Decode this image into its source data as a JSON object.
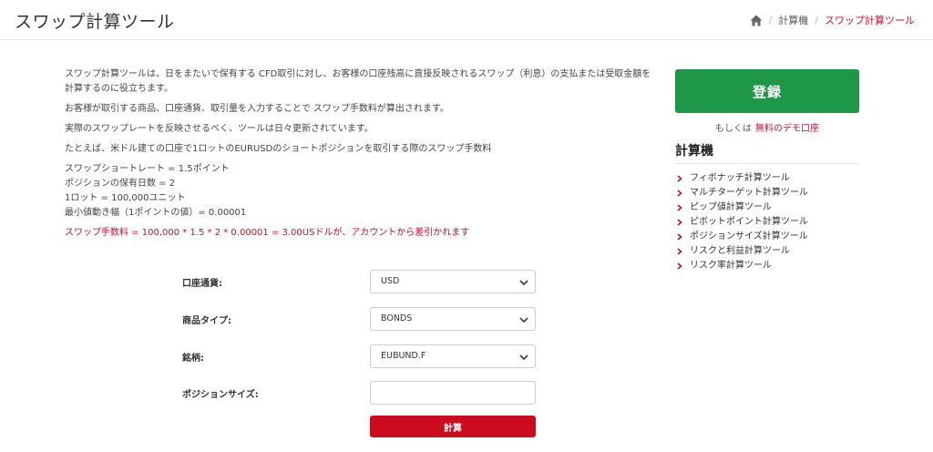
{
  "header": {
    "title": "スワップ計算ツール",
    "breadcrumb": {
      "home_icon": "home-icon",
      "items": [
        "計算機",
        "スワップ計算ツール"
      ]
    }
  },
  "main": {
    "intro": "スワップ計算ツールは、日をまたいで保有する CFD取引に対し、お客様の口座残高に直接反映されるスワップ（利息）の支払または受取金額を計算するのに役立ちます。",
    "para2": "お客様が取引する商品、口座通貨、取引量を入力することで スワップ手数料が算出されます。",
    "para3": "実際のスワップレートを反映させるべく、ツールは日々更新されています。",
    "para4": "たとえば、米ドル建ての口座で1ロットのEURUSDのショートポジションを取引する際のスワップ手数料",
    "example_lines": [
      "スワップショートレート = 1.5ポイント",
      "ポジションの保有日数 = 2",
      "1ロット = 100,000ユニット",
      "最小値動き幅（1ポイントの値）= 0.00001"
    ],
    "result": "スワップ手数料 = 100,000 * 1.5 * 2 * 0.00001 = 3.00USドルが、アカウントから差引かれます"
  },
  "form": {
    "account_currency": {
      "label": "口座通貨:",
      "value": "USD"
    },
    "product_type": {
      "label": "商品タイプ:",
      "value": "BONDS"
    },
    "symbol": {
      "label": "銘柄:",
      "value": "EUBUND.F"
    },
    "position_size": {
      "label": "ポジションサイズ:",
      "value": ""
    },
    "calculate_label": "計算"
  },
  "sidebar": {
    "register_label": "登録",
    "or_text": "もしくは",
    "demo_link": "無料のデモ口座",
    "heading": "計算機",
    "tools": [
      "フィボナッチ計算ツール",
      "マルチターゲット計算ツール",
      "ピップ値計算ツール",
      "ピボットポイント計算ツール",
      "ポジションサイズ計算ツール",
      "リスクと利益計算ツール",
      "リスク率計算ツール"
    ]
  },
  "colors": {
    "accent_red": "#c8102e",
    "button_red": "#cc0b1e",
    "register_green": "#1e9748"
  }
}
